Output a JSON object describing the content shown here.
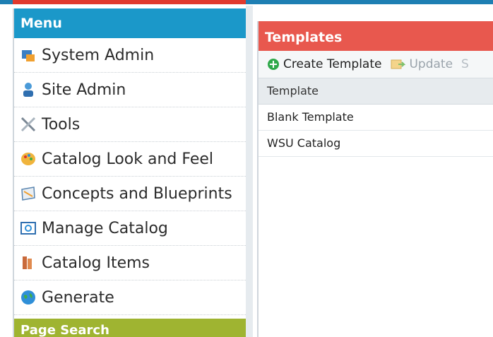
{
  "menu": {
    "title": "Menu",
    "items": [
      {
        "label": "System Admin",
        "icon": "system-admin-icon"
      },
      {
        "label": "Site Admin",
        "icon": "site-admin-icon"
      },
      {
        "label": "Tools",
        "icon": "tools-icon"
      },
      {
        "label": "Catalog Look and Feel",
        "icon": "palette-icon"
      },
      {
        "label": "Concepts and Blueprints",
        "icon": "blueprint-icon"
      },
      {
        "label": "Manage Catalog",
        "icon": "manage-catalog-icon"
      },
      {
        "label": "Catalog Items",
        "icon": "catalog-items-icon"
      },
      {
        "label": "Generate",
        "icon": "globe-icon"
      }
    ]
  },
  "page_search": {
    "title": "Page Search"
  },
  "templates": {
    "title": "Templates",
    "toolbar": {
      "create_label": "Create Template",
      "update_label": "Update",
      "more_label": "S"
    },
    "column_header": "Template",
    "rows": [
      "Blank Template",
      "WSU Catalog"
    ]
  },
  "colors": {
    "menu_header": "#1b98c9",
    "templates_header": "#e8584e",
    "page_search_header": "#9fb431"
  }
}
